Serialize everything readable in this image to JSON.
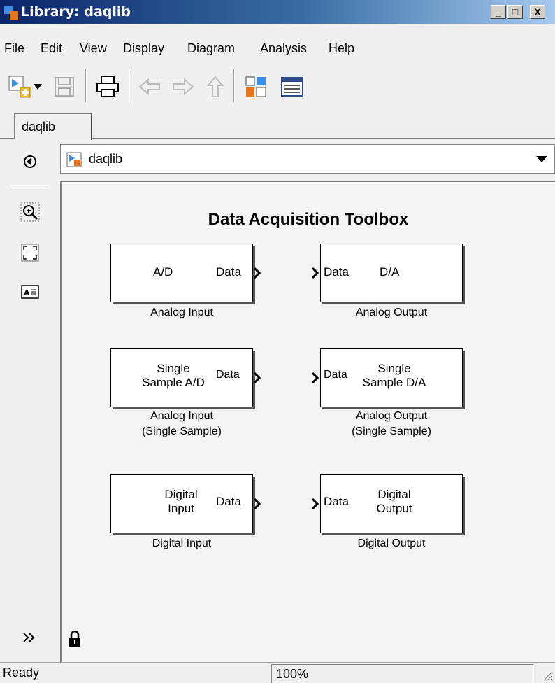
{
  "window": {
    "title": "Library: daqlib",
    "minimize_label": "_",
    "maximize_label": "□",
    "close_label": "X"
  },
  "menu": {
    "items": [
      {
        "label": "File"
      },
      {
        "label": "Edit"
      },
      {
        "label": "View"
      },
      {
        "label": "Display"
      },
      {
        "label": "Diagram"
      },
      {
        "label": "Analysis"
      },
      {
        "label": "Help"
      }
    ]
  },
  "toolbar": {
    "icons": [
      "new-model-icon",
      "dropdown-arrow-icon",
      "save-icon",
      "print-icon",
      "back-icon",
      "forward-icon",
      "up-icon",
      "library-browser-icon",
      "model-explorer-icon"
    ]
  },
  "tabs": [
    {
      "label": "daqlib"
    }
  ],
  "address": {
    "path": "daqlib"
  },
  "canvas": {
    "title": "Data Acquisition Toolbox",
    "blocks": [
      {
        "main": "A/D",
        "port": "Data",
        "caption_1": "Analog Input",
        "caption_2": ""
      },
      {
        "main": "D/A",
        "port": "Data",
        "caption_1": "Analog Output",
        "caption_2": ""
      },
      {
        "main_1": "Single",
        "main_2": "Sample A/D",
        "port": "Data",
        "caption_1": "Analog Input",
        "caption_2": "(Single Sample)"
      },
      {
        "main_1": "Single",
        "main_2": "Sample D/A",
        "port": "Data",
        "caption_1": "Analog Output",
        "caption_2": "(Single Sample)"
      },
      {
        "main_1": "Digital",
        "main_2": "Input",
        "port": "Data",
        "caption_1": "Digital Input",
        "caption_2": ""
      },
      {
        "main_1": "Digital",
        "main_2": "Output",
        "port": "Data",
        "caption_1": "Digital Output",
        "caption_2": ""
      }
    ]
  },
  "status": {
    "text": "Ready",
    "zoom": "100%"
  },
  "colors": {
    "titlebar_start": "#0a246a",
    "titlebar_end": "#a6caf0",
    "canvas_bg": "#f4f4f4"
  }
}
